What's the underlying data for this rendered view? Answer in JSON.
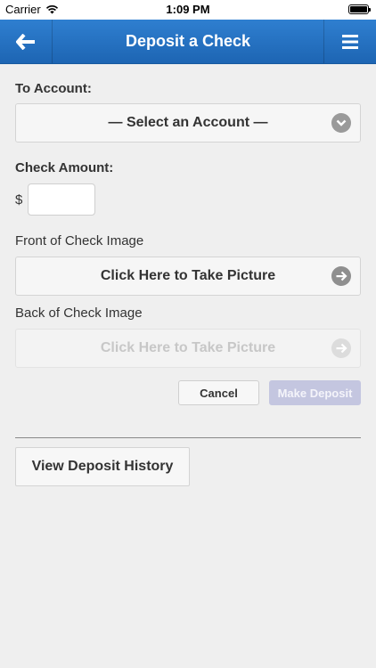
{
  "status_bar": {
    "carrier": "Carrier",
    "time": "1:09 PM"
  },
  "nav": {
    "title": "Deposit a Check"
  },
  "to_account": {
    "label": "To Account:",
    "select_value": "— Select an Account —"
  },
  "check_amount": {
    "label": "Check Amount:",
    "currency": "$",
    "value": ""
  },
  "front": {
    "label": "Front of Check Image",
    "button": "Click Here to Take Picture"
  },
  "back": {
    "label": "Back of Check Image",
    "button": "Click Here to Take Picture"
  },
  "actions": {
    "cancel": "Cancel",
    "make_deposit": "Make Deposit"
  },
  "history": {
    "button": "View Deposit History"
  },
  "colors": {
    "nav_top": "#2f7fd0",
    "nav_bottom": "#1d65b3",
    "background": "#efefef",
    "disabled_primary": "#c4c6e0"
  }
}
